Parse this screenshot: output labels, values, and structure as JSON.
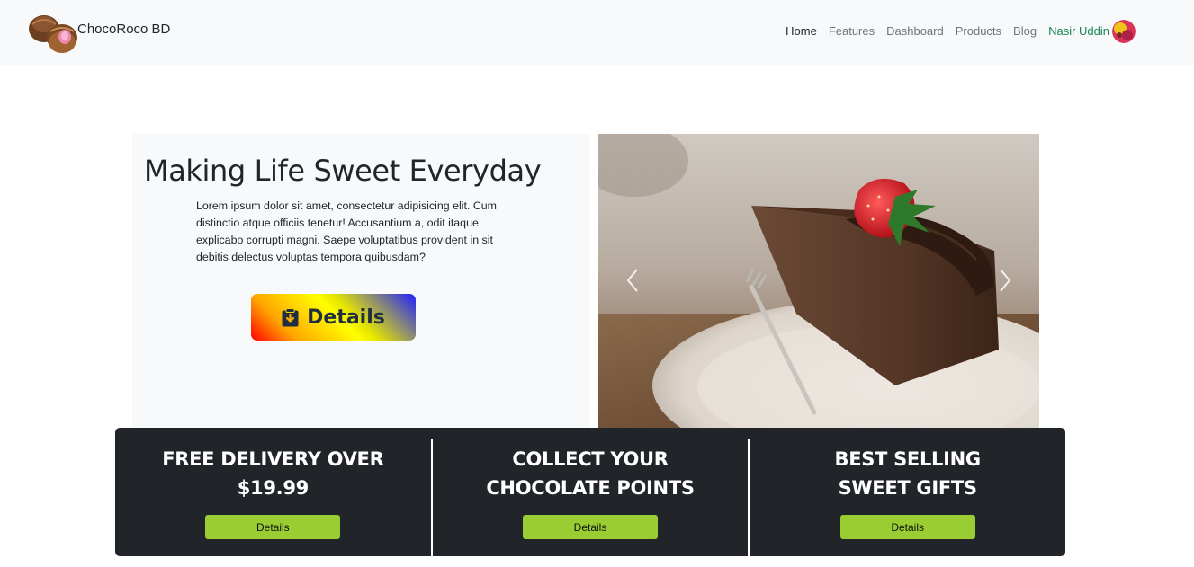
{
  "navbar": {
    "brand": "ChocoRoco BD",
    "links": [
      "Home",
      "Features",
      "Dashboard",
      "Products",
      "Blog"
    ],
    "active_link": "Home",
    "user_name": "Nasir Uddin"
  },
  "hero": {
    "title": "Making Life Sweet Everyday",
    "text": "Lorem ipsum dolor sit amet, consectetur adipisicing elit. Cum distinctio atque officiis tenetur! Accusantium a, odit itaque explicabo corrupti magni. Saepe voluptatibus provident in sit debitis delectus voluptas tempora quibusdam?",
    "button_label": "Details",
    "button_icon": "clipboard-download-icon"
  },
  "carousel": {
    "image": "chocolate-cake-with-strawberry",
    "prev_icon": "chevron-left-icon",
    "next_icon": "chevron-right-icon"
  },
  "features": [
    {
      "title": "FREE DELIVERY OVER\n$19.99",
      "button_label": "Details"
    },
    {
      "title": "COLLECT YOUR\nCHOCOLATE POINTS",
      "button_label": "Details"
    },
    {
      "title": "BEST SELLING\nSWEET GIFTS",
      "button_label": "Details"
    }
  ],
  "colors": {
    "feature_bg": "#212529",
    "feature_button": "#9acd32",
    "user_link": "#198754",
    "navbar_bg": "#f8f9fa"
  }
}
